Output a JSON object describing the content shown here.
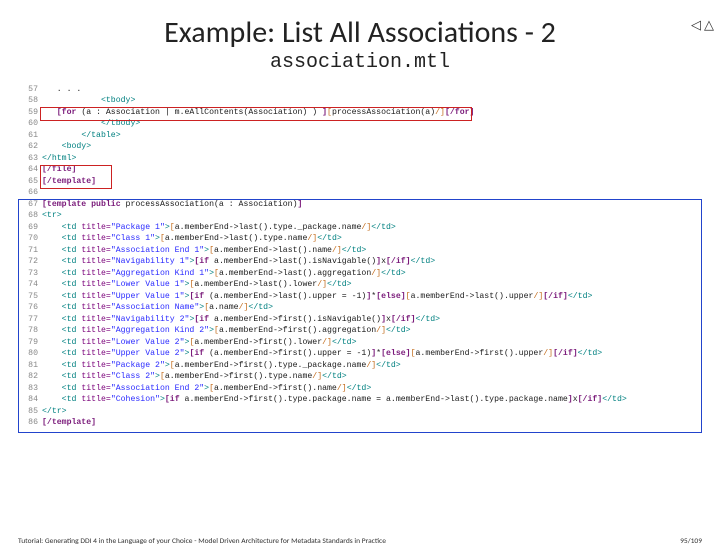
{
  "nav": {
    "prev": "◁",
    "next": "△"
  },
  "title": "Example: List All Associations - 2",
  "subtitle": "association.mtl",
  "lines": [
    {
      "n": "57",
      "ind": "   ",
      "html": "<span class='txt'>. . .</span>"
    },
    {
      "n": "58",
      "ind": "            ",
      "html": "<span class='tag'>&lt;tbody&gt;</span>"
    },
    {
      "n": "59",
      "ind": "   ",
      "html": "<span class='kw'>[for</span> <span class='txt'>(a : Association | m.eAllContents(Association) )</span> <span class='kw'>]</span><span class='br'>[</span><span class='txt'>processAssociation(a)</span><span class='br'>/]</span><span class='kw'>[/for]</span>"
    },
    {
      "n": "60",
      "ind": "            ",
      "html": "<span class='tag'>&lt;/tbody&gt;</span>"
    },
    {
      "n": "61",
      "ind": "        ",
      "html": "<span class='tag'>&lt;/table&gt;</span>"
    },
    {
      "n": "62",
      "ind": "    ",
      "html": "<span class='tag'>&lt;body&gt;</span>"
    },
    {
      "n": "63",
      "ind": "",
      "html": "<span class='tag'>&lt;/html&gt;</span>"
    },
    {
      "n": "64",
      "ind": "",
      "html": "<span class='kw'>[/file]</span>"
    },
    {
      "n": "65",
      "ind": "",
      "html": "<span class='kw'>[/template]</span>"
    },
    {
      "n": "66",
      "ind": "",
      "html": ""
    },
    {
      "n": "67",
      "ind": "",
      "html": "<span class='kw'>[template public</span> <span class='txt'>processAssociation(a : Association)</span><span class='kw'>]</span>"
    },
    {
      "n": "68",
      "ind": "",
      "html": "<span class='tag'>&lt;tr&gt;</span>"
    },
    {
      "n": "69",
      "ind": "    ",
      "html": "<span class='tag'>&lt;td</span> <span class='attr'>title=</span><span class='str'>\"Package 1\"</span><span class='tag'>&gt;</span><span class='br'>[</span><span class='txt'>a.memberEnd-&gt;last().type._package.name</span><span class='br'>/]</span><span class='tag'>&lt;/td&gt;</span>"
    },
    {
      "n": "70",
      "ind": "    ",
      "html": "<span class='tag'>&lt;td</span> <span class='attr'>title=</span><span class='str'>\"Class 1\"</span><span class='tag'>&gt;</span><span class='br'>[</span><span class='txt'>a.memberEnd-&gt;last().type.name</span><span class='br'>/]</span><span class='tag'>&lt;/td&gt;</span>"
    },
    {
      "n": "71",
      "ind": "    ",
      "html": "<span class='tag'>&lt;td</span> <span class='attr'>title=</span><span class='str'>\"Association End 1\"</span><span class='tag'>&gt;</span><span class='br'>[</span><span class='txt'>a.memberEnd-&gt;last().name</span><span class='br'>/]</span><span class='tag'>&lt;/td&gt;</span>"
    },
    {
      "n": "72",
      "ind": "    ",
      "html": "<span class='tag'>&lt;td</span> <span class='attr'>title=</span><span class='str'>\"Navigability 1\"</span><span class='tag'>&gt;</span><span class='kw'>[if</span> <span class='txt'>a.memberEnd-&gt;last().isNavigable()</span><span class='kw'>]</span><span class='txt'>x</span><span class='kw'>[/if]</span><span class='tag'>&lt;/td&gt;</span>"
    },
    {
      "n": "73",
      "ind": "    ",
      "html": "<span class='tag'>&lt;td</span> <span class='attr'>title=</span><span class='str'>\"Aggregation Kind 1\"</span><span class='tag'>&gt;</span><span class='br'>[</span><span class='txt'>a.memberEnd-&gt;last().aggregation</span><span class='br'>/]</span><span class='tag'>&lt;/td&gt;</span>"
    },
    {
      "n": "74",
      "ind": "    ",
      "html": "<span class='tag'>&lt;td</span> <span class='attr'>title=</span><span class='str'>\"Lower Value 1\"</span><span class='tag'>&gt;</span><span class='br'>[</span><span class='txt'>a.memberEnd-&gt;last().lower</span><span class='br'>/]</span><span class='tag'>&lt;/td&gt;</span>"
    },
    {
      "n": "75",
      "ind": "    ",
      "html": "<span class='tag'>&lt;td</span> <span class='attr'>title=</span><span class='str'>\"Upper Value 1\"</span><span class='tag'>&gt;</span><span class='kw'>[if</span> <span class='txt'>(a.memberEnd-&gt;last().upper = -1)</span><span class='kw'>]</span><span class='txt'>*</span><span class='kw'>[else]</span><span class='br'>[</span><span class='txt'>a.memberEnd-&gt;last().upper</span><span class='br'>/]</span><span class='kw'>[/if]</span><span class='tag'>&lt;/td&gt;</span>"
    },
    {
      "n": "76",
      "ind": "    ",
      "html": "<span class='tag'>&lt;td</span> <span class='attr'>title=</span><span class='str'>\"Association Name\"</span><span class='tag'>&gt;</span><span class='br'>[</span><span class='txt'>a.name</span><span class='br'>/]</span><span class='tag'>&lt;/td&gt;</span>"
    },
    {
      "n": "77",
      "ind": "    ",
      "html": "<span class='tag'>&lt;td</span> <span class='attr'>title=</span><span class='str'>\"Navigability 2\"</span><span class='tag'>&gt;</span><span class='kw'>[if</span> <span class='txt'>a.memberEnd-&gt;first().isNavigable()</span><span class='kw'>]</span><span class='txt'>x</span><span class='kw'>[/if]</span><span class='tag'>&lt;/td&gt;</span>"
    },
    {
      "n": "78",
      "ind": "    ",
      "html": "<span class='tag'>&lt;td</span> <span class='attr'>title=</span><span class='str'>\"Aggregation Kind 2\"</span><span class='tag'>&gt;</span><span class='br'>[</span><span class='txt'>a.memberEnd-&gt;first().aggregation</span><span class='br'>/]</span><span class='tag'>&lt;/td&gt;</span>"
    },
    {
      "n": "79",
      "ind": "    ",
      "html": "<span class='tag'>&lt;td</span> <span class='attr'>title=</span><span class='str'>\"Lower Value 2\"</span><span class='tag'>&gt;</span><span class='br'>[</span><span class='txt'>a.memberEnd-&gt;first().lower</span><span class='br'>/]</span><span class='tag'>&lt;/td&gt;</span>"
    },
    {
      "n": "80",
      "ind": "    ",
      "html": "<span class='tag'>&lt;td</span> <span class='attr'>title=</span><span class='str'>\"Upper Value 2\"</span><span class='tag'>&gt;</span><span class='kw'>[if</span> <span class='txt'>(a.memberEnd-&gt;first().upper = -1)</span><span class='kw'>]</span><span class='txt'>*</span><span class='kw'>[else]</span><span class='br'>[</span><span class='txt'>a.memberEnd-&gt;first().upper</span><span class='br'>/]</span><span class='kw'>[/if]</span><span class='tag'>&lt;/td&gt;</span>"
    },
    {
      "n": "81",
      "ind": "    ",
      "html": "<span class='tag'>&lt;td</span> <span class='attr'>title=</span><span class='str'>\"Package 2\"</span><span class='tag'>&gt;</span><span class='br'>[</span><span class='txt'>a.memberEnd-&gt;first().type._package.name</span><span class='br'>/]</span><span class='tag'>&lt;/td&gt;</span>"
    },
    {
      "n": "82",
      "ind": "    ",
      "html": "<span class='tag'>&lt;td</span> <span class='attr'>title=</span><span class='str'>\"Class 2\"</span><span class='tag'>&gt;</span><span class='br'>[</span><span class='txt'>a.memberEnd-&gt;first().type.name</span><span class='br'>/]</span><span class='tag'>&lt;/td&gt;</span>"
    },
    {
      "n": "83",
      "ind": "    ",
      "html": "<span class='tag'>&lt;td</span> <span class='attr'>title=</span><span class='str'>\"Association End 2\"</span><span class='tag'>&gt;</span><span class='br'>[</span><span class='txt'>a.memberEnd-&gt;first().name</span><span class='br'>/]</span><span class='tag'>&lt;/td&gt;</span>"
    },
    {
      "n": "84",
      "ind": "    ",
      "html": "<span class='tag'>&lt;td</span> <span class='attr'>title=</span><span class='str'>\"Cohesion\"</span><span class='tag'>&gt;</span><span class='kw'>[if</span> <span class='txt'>a.memberEnd-&gt;first().type.package.name = a.memberEnd-&gt;last().type.package.name</span><span class='kw'>]</span><span class='txt'>x</span><span class='kw'>[/if]</span><span class='tag'>&lt;/td&gt;</span>"
    },
    {
      "n": "85",
      "ind": "",
      "html": "<span class='tag'>&lt;/tr&gt;</span>"
    },
    {
      "n": "86",
      "ind": "",
      "html": "<span class='kw'>[/template]</span>"
    }
  ],
  "footer": {
    "left": "Tutorial: Generating DDI 4 in the Language of your Choice - Model Driven Architecture for Metadata Standards in Practice",
    "right": "95/109"
  }
}
